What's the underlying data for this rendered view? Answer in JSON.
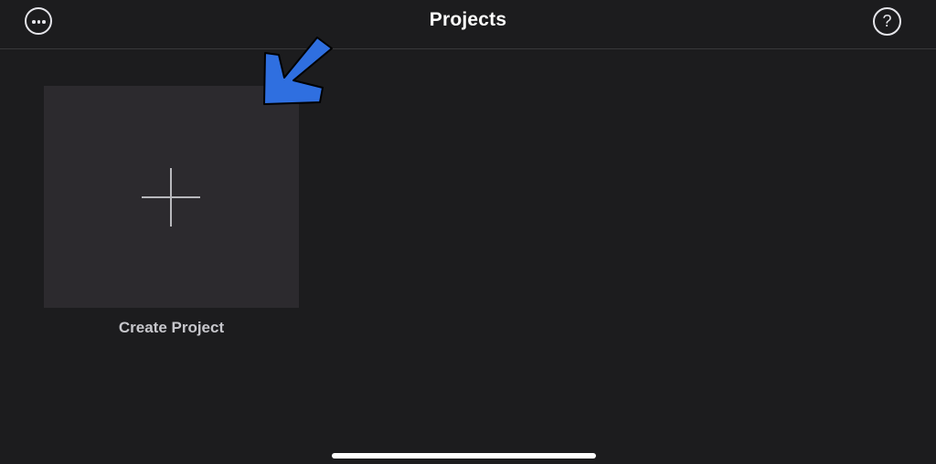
{
  "header": {
    "title": "Projects",
    "more_icon": "ellipsis-circle-icon",
    "help_icon": "question-circle-icon",
    "help_glyph": "?"
  },
  "create_project": {
    "label": "Create Project",
    "icon": "plus-icon"
  },
  "annotation": {
    "icon": "arrow-pointer-icon",
    "color": "#2f6fe0"
  },
  "colors": {
    "background": "#1c1c1e",
    "tile": "#2c2a2e",
    "title_text": "#ffffff",
    "label_text": "#c7c7cc"
  }
}
